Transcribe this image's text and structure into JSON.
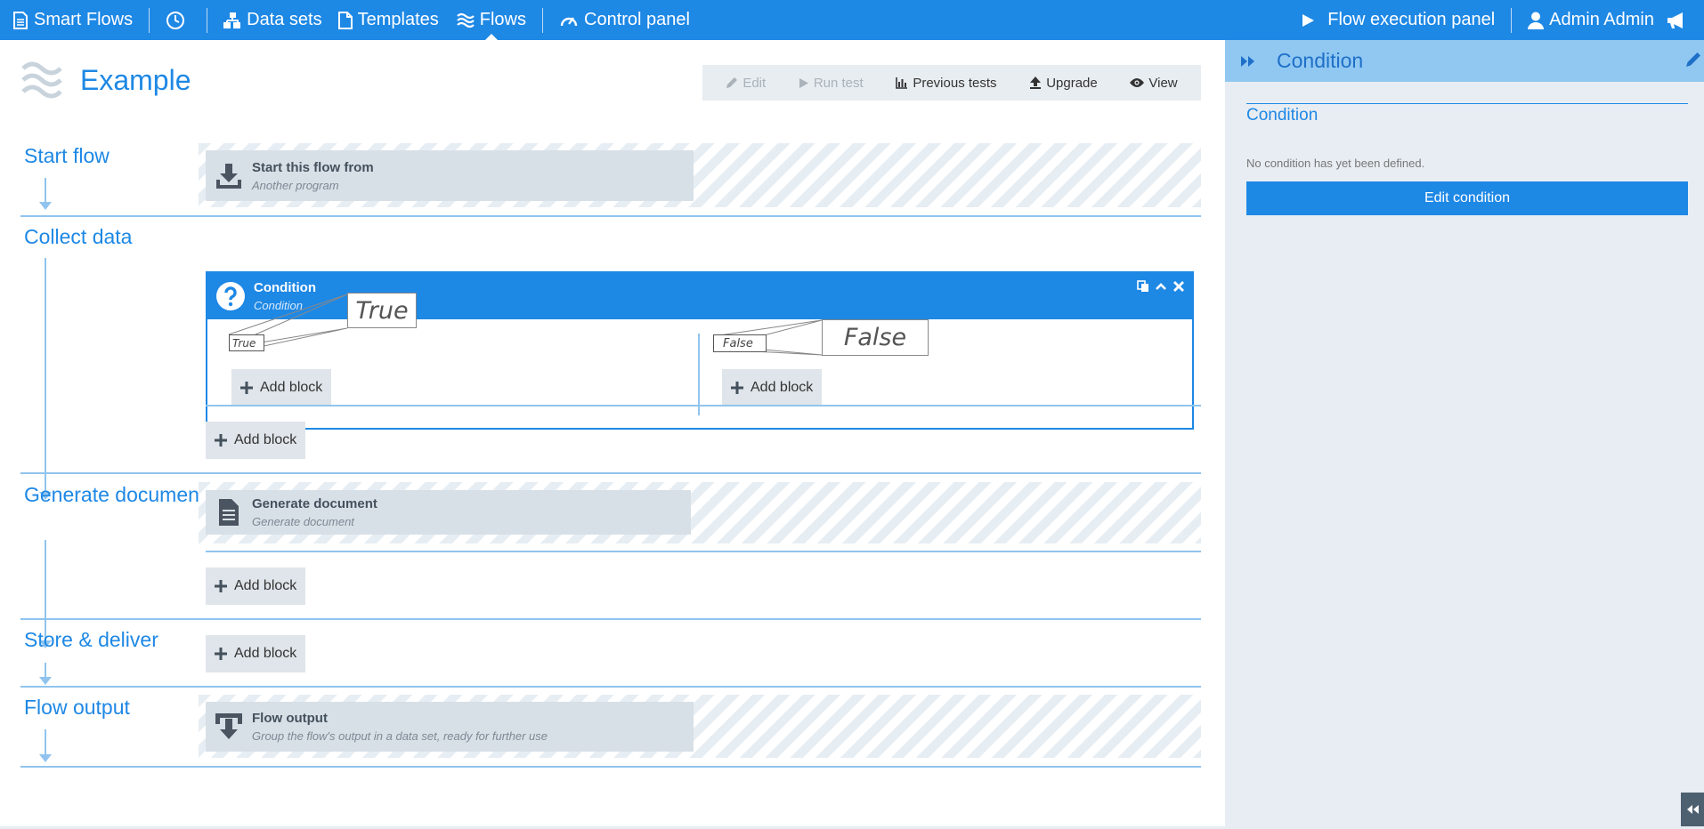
{
  "nav": {
    "brand": "Smart Flows",
    "items": [
      {
        "label": "Data sets",
        "icon": "sitemap-icon"
      },
      {
        "label": "Templates",
        "icon": "file-icon"
      },
      {
        "label": "Flows",
        "icon": "flows-icon",
        "active": true
      },
      {
        "label": "Control panel",
        "icon": "dashboard-icon"
      }
    ],
    "right": {
      "execution_label": "Flow execution panel",
      "user_label": "Admin Admin"
    },
    "accent": "#1e88e5"
  },
  "page": {
    "title": "Example"
  },
  "toolbar": {
    "edit": "Edit",
    "run_test": "Run test",
    "previous_tests": "Previous tests",
    "upgrade": "Upgrade",
    "view": "View"
  },
  "stages": {
    "start_flow": "Start flow",
    "collect_data": "Collect data",
    "generate_documents": "Generate documents",
    "store_deliver": "Store & deliver",
    "flow_output": "Flow output"
  },
  "blocks": {
    "start": {
      "title": "Start this flow from",
      "subtitle": "Another program"
    },
    "condition": {
      "title": "Condition",
      "subtitle": "Condition",
      "true_label": "True",
      "false_label": "False"
    },
    "generate": {
      "title": "Generate document",
      "subtitle": "Generate document"
    },
    "output": {
      "title": "Flow output",
      "subtitle": "Group the flow's output in a data set, ready for further use"
    }
  },
  "add_block_label": "Add block",
  "side_panel": {
    "header": "Condition",
    "section_title": "Condition",
    "message": "No condition has yet been defined.",
    "button": "Edit condition"
  }
}
